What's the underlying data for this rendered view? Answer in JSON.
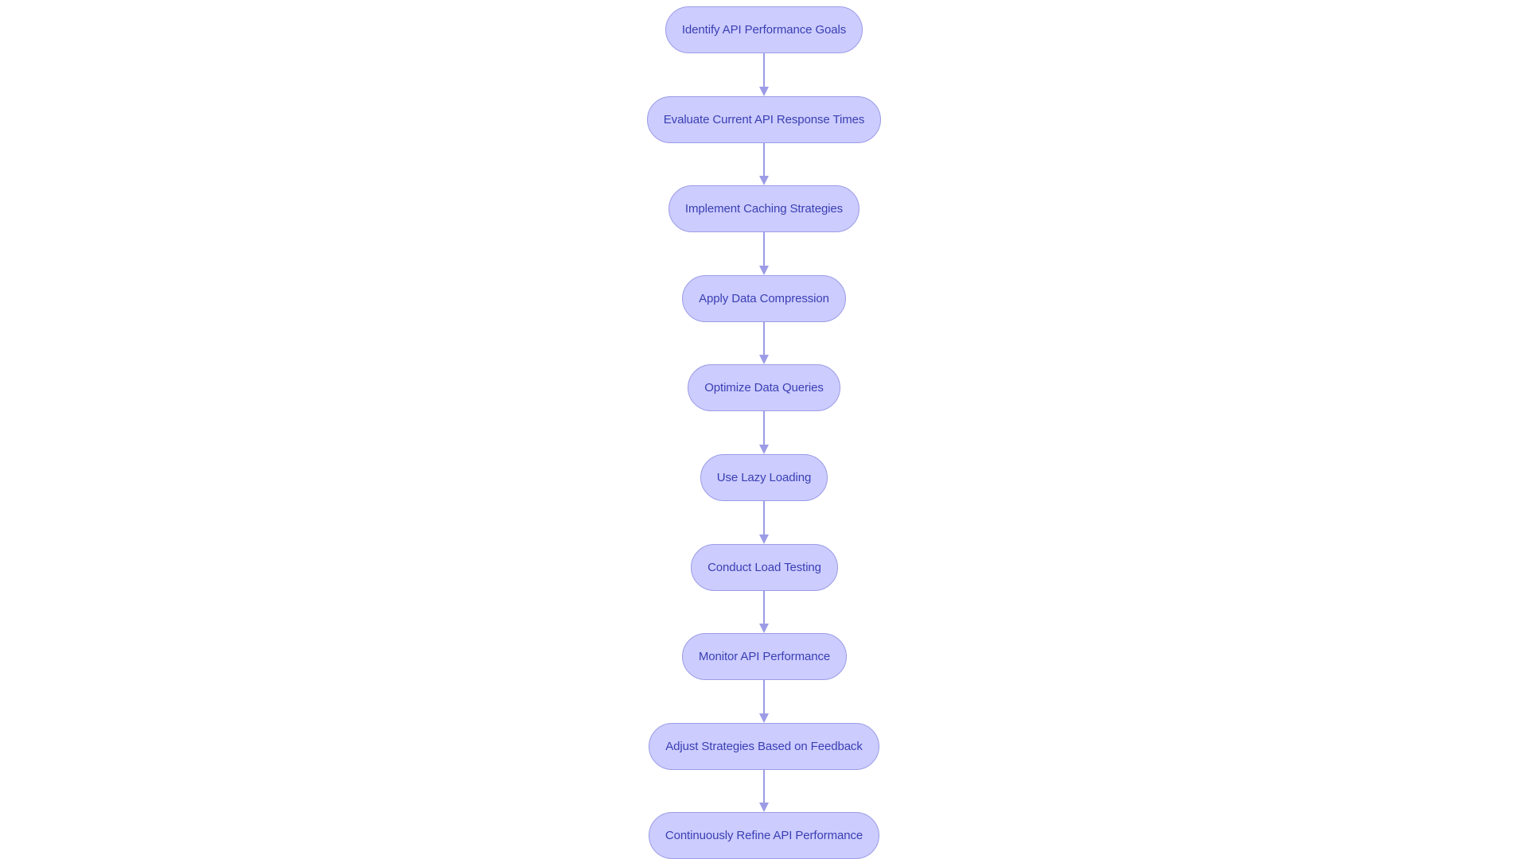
{
  "diagram": {
    "type": "flowchart",
    "direction": "top-to-bottom",
    "colors": {
      "node_fill": "#ccccff",
      "node_border": "#9c9ce6",
      "node_text": "#3a3fb2",
      "edge": "#9c9ce6",
      "background": "#ffffff"
    },
    "nodes": [
      {
        "id": "n1",
        "label": "Identify API Performance Goals"
      },
      {
        "id": "n2",
        "label": "Evaluate Current API Response Times"
      },
      {
        "id": "n3",
        "label": "Implement Caching Strategies"
      },
      {
        "id": "n4",
        "label": "Apply Data Compression"
      },
      {
        "id": "n5",
        "label": "Optimize Data Queries"
      },
      {
        "id": "n6",
        "label": "Use Lazy Loading"
      },
      {
        "id": "n7",
        "label": "Conduct Load Testing"
      },
      {
        "id": "n8",
        "label": "Monitor API Performance"
      },
      {
        "id": "n9",
        "label": "Adjust Strategies Based on Feedback"
      },
      {
        "id": "n10",
        "label": "Continuously Refine API Performance"
      }
    ],
    "edges": [
      {
        "from": "n1",
        "to": "n2"
      },
      {
        "from": "n2",
        "to": "n3"
      },
      {
        "from": "n3",
        "to": "n4"
      },
      {
        "from": "n4",
        "to": "n5"
      },
      {
        "from": "n5",
        "to": "n6"
      },
      {
        "from": "n6",
        "to": "n7"
      },
      {
        "from": "n7",
        "to": "n8"
      },
      {
        "from": "n8",
        "to": "n9"
      },
      {
        "from": "n9",
        "to": "n10"
      }
    ]
  }
}
